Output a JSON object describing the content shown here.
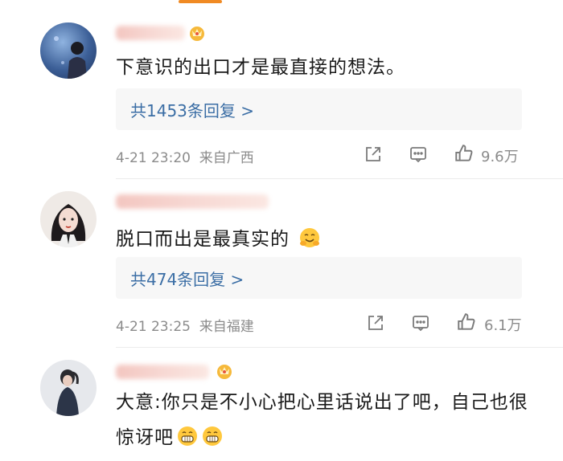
{
  "comments": [
    {
      "text": "下意识的出口才是最直接的想法。",
      "replies_label": "共1453条回复 >",
      "time": "4-21 23:20",
      "location": "来自广西",
      "likes": "9.6万"
    },
    {
      "text": "脱口而出是最真实的",
      "emoji": "hugging-face",
      "replies_label": "共474条回复 >",
      "time": "4-21 23:25",
      "location": "来自福建",
      "likes": "6.1万"
    },
    {
      "text": "大意:你只是不小心把心里话说出了吧，自己也很惊讶吧",
      "emoji": "grinning-face"
    }
  ],
  "icons": [
    "share-icon",
    "comment-icon",
    "like-icon",
    "vip-badge-icon"
  ],
  "colors": {
    "accent": "#f08a24",
    "link": "#3b6ea5",
    "meta": "#8b8b8b",
    "text": "#1a1a1a"
  }
}
